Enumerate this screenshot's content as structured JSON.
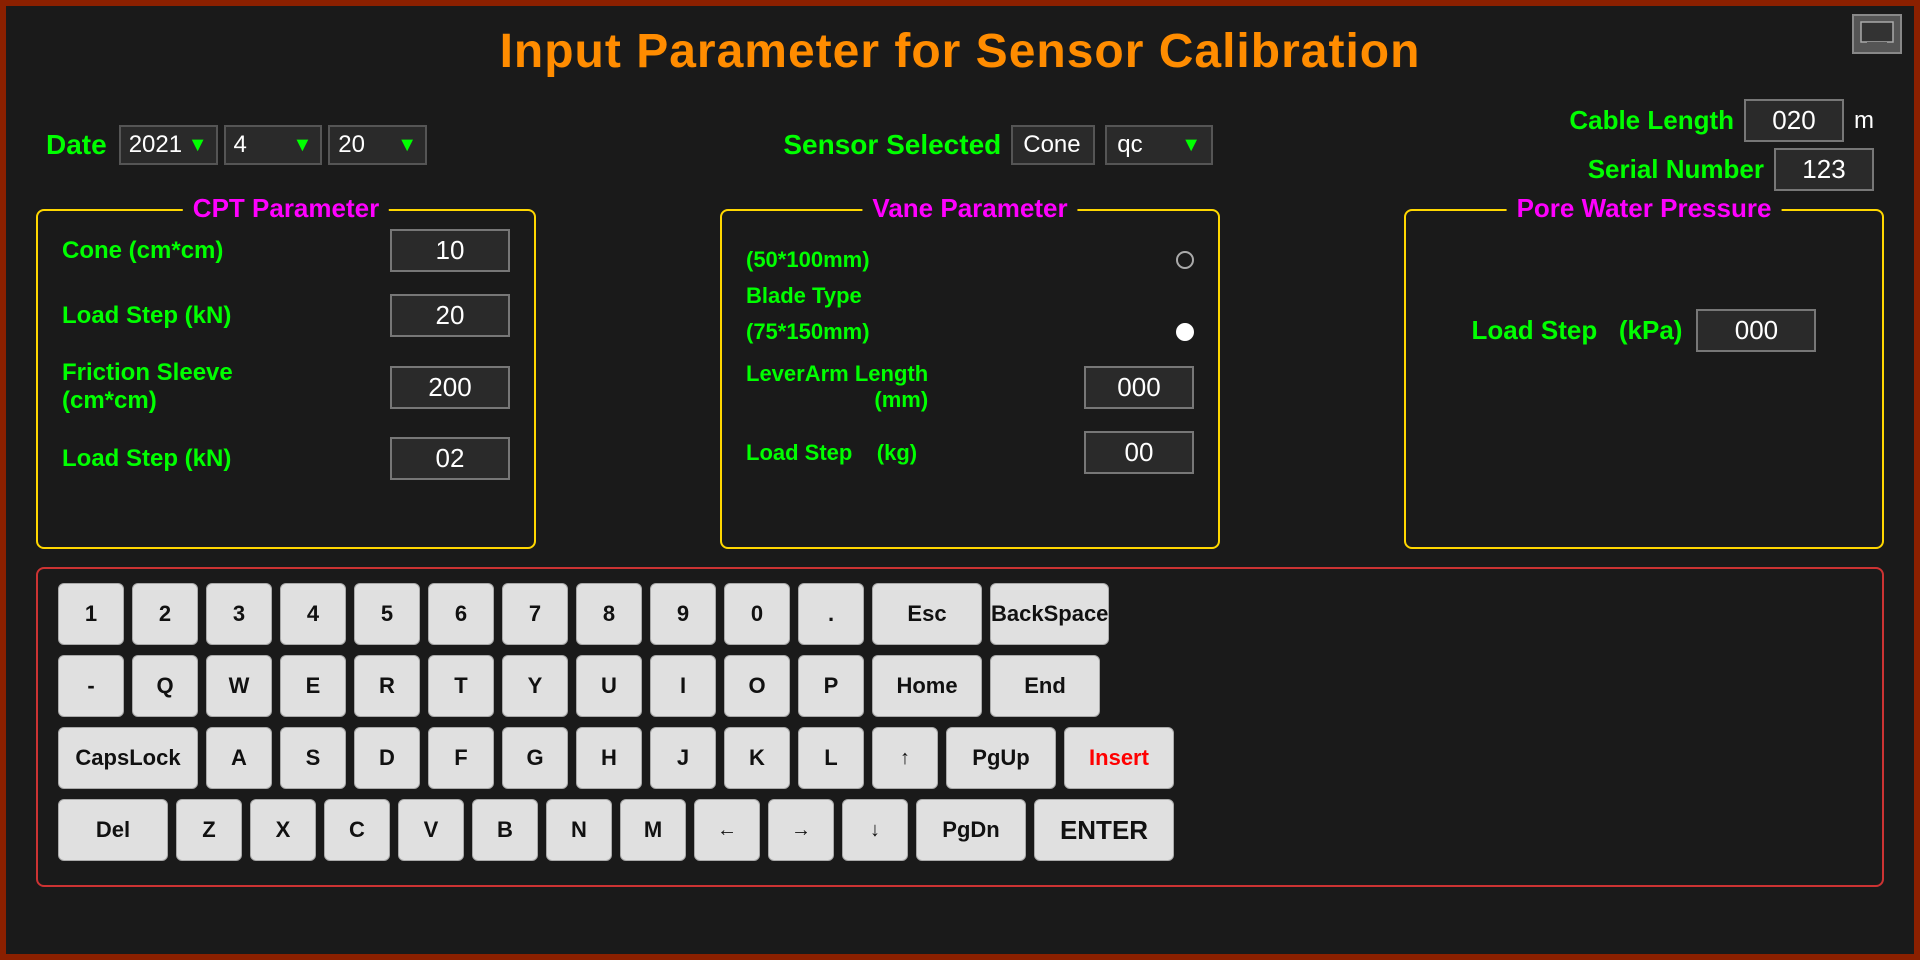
{
  "page": {
    "title": "Input Parameter for Sensor Calibration",
    "bg_color": "#1a1a1a"
  },
  "header": {
    "date_label": "Date",
    "date_year": "2021",
    "date_month": "4",
    "date_day": "20",
    "sensor_label": "Sensor Selected",
    "sensor_type": "Cone",
    "sensor_subtype": "qc",
    "cable_length_label": "Cable Length",
    "cable_length_value": "020",
    "cable_length_unit": "m",
    "serial_number_label": "Serial Number",
    "serial_number_value": "123"
  },
  "cpt_panel": {
    "title": "CPT Parameter",
    "rows": [
      {
        "label": "Cone (cm*cm)",
        "value": "10"
      },
      {
        "label": "Load Step (kN)",
        "value": "20"
      },
      {
        "label": "Friction Sleeve\n(cm*cm)",
        "value": "200"
      },
      {
        "label": "Load Step (kN)",
        "value": "02"
      }
    ]
  },
  "vane_panel": {
    "title": "Vane Parameter",
    "blade_label": "Blade Type",
    "option1": "(50*100mm)",
    "option2": "(75*150mm)",
    "option1_selected": false,
    "option2_selected": true,
    "lever_label": "LeverArm Length\n(mm)",
    "lever_value": "000",
    "loadstep_label": "Load Step    (kg)",
    "loadstep_value": "00"
  },
  "pore_panel": {
    "title": "Pore Water Pressure",
    "loadstep_label": "Load Step",
    "loadstep_unit": "(kPa)",
    "loadstep_value": "000"
  },
  "keyboard": {
    "row1": [
      "1",
      "2",
      "3",
      "4",
      "5",
      "6",
      "7",
      "8",
      "9",
      "0",
      ".",
      "Esc",
      "BackSpace"
    ],
    "row2": [
      "-",
      "Q",
      "W",
      "E",
      "R",
      "T",
      "Y",
      "U",
      "I",
      "O",
      "P",
      "Home",
      "End"
    ],
    "row3": [
      "CapsLock",
      "A",
      "S",
      "D",
      "F",
      "G",
      "H",
      "J",
      "K",
      "L",
      "↑",
      "PgUp",
      "Insert"
    ],
    "row4": [
      "Del",
      "Z",
      "X",
      "C",
      "V",
      "B",
      "N",
      "M",
      "←",
      "→",
      "↓",
      "PgDn",
      "ENTER"
    ]
  }
}
